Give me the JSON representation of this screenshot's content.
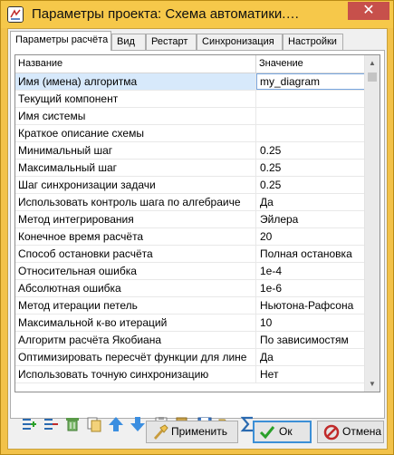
{
  "window": {
    "title": "Параметры проекта: Схема автоматики.р...",
    "close_glyph": "✕"
  },
  "tabs": [
    {
      "label": "Параметры расчёта",
      "active": true
    },
    {
      "label": "Вид",
      "active": false
    },
    {
      "label": "Рестарт",
      "active": false
    },
    {
      "label": "Синхронизация",
      "active": false
    },
    {
      "label": "Настройки",
      "active": false
    }
  ],
  "grid": {
    "col_name": "Название",
    "col_value": "Значение",
    "rows": [
      {
        "name": "Имя (имена) алгоритма",
        "value": "my_diagram",
        "selected": true
      },
      {
        "name": "Текущий компонент",
        "value": ""
      },
      {
        "name": "Имя системы",
        "value": ""
      },
      {
        "name": "Краткое описание схемы",
        "value": ""
      },
      {
        "name": "Минимальный шаг",
        "value": "0.25"
      },
      {
        "name": "Максимальный шаг",
        "value": "0.25"
      },
      {
        "name": "Шаг синхронизации задачи",
        "value": "0.25"
      },
      {
        "name": "Использовать контроль шага по алгебраиче",
        "value": "Да"
      },
      {
        "name": "Метод интегрирования",
        "value": "Эйлера"
      },
      {
        "name": "Конечное время расчёта",
        "value": "20"
      },
      {
        "name": "Способ остановки расчёта",
        "value": "Полная остановка"
      },
      {
        "name": "Относительная ошибка",
        "value": "1e-4"
      },
      {
        "name": "Абсолютная ошибка",
        "value": "1e-6"
      },
      {
        "name": "Метод итерации петель",
        "value": "Ньютона-Рафсона"
      },
      {
        "name": "Максимальной к-во итераций",
        "value": "10"
      },
      {
        "name": "Алгоритм расчёта Якобиана",
        "value": "По зависимостям"
      },
      {
        "name": "Оптимизировать пересчёт функции для лине",
        "value": "Да"
      },
      {
        "name": "Использовать точную синхронизацию",
        "value": "Нет"
      }
    ]
  },
  "toolbar": {
    "icons": [
      "add-row-icon",
      "remove-row-icon",
      "delete-icon",
      "copy-icon",
      "move-up-icon",
      "move-down-icon",
      "clipboard-icon",
      "paste-icon",
      "save-icon",
      "open-folder-icon",
      "sum-icon"
    ]
  },
  "buttons": {
    "apply": "Применить",
    "ok": "Ок",
    "cancel": "Отмена"
  },
  "colors": {
    "accent": "#3c8fd6",
    "titlebar": "#f6c84a",
    "close": "#c7504b",
    "selection": "#d7e9fb"
  }
}
